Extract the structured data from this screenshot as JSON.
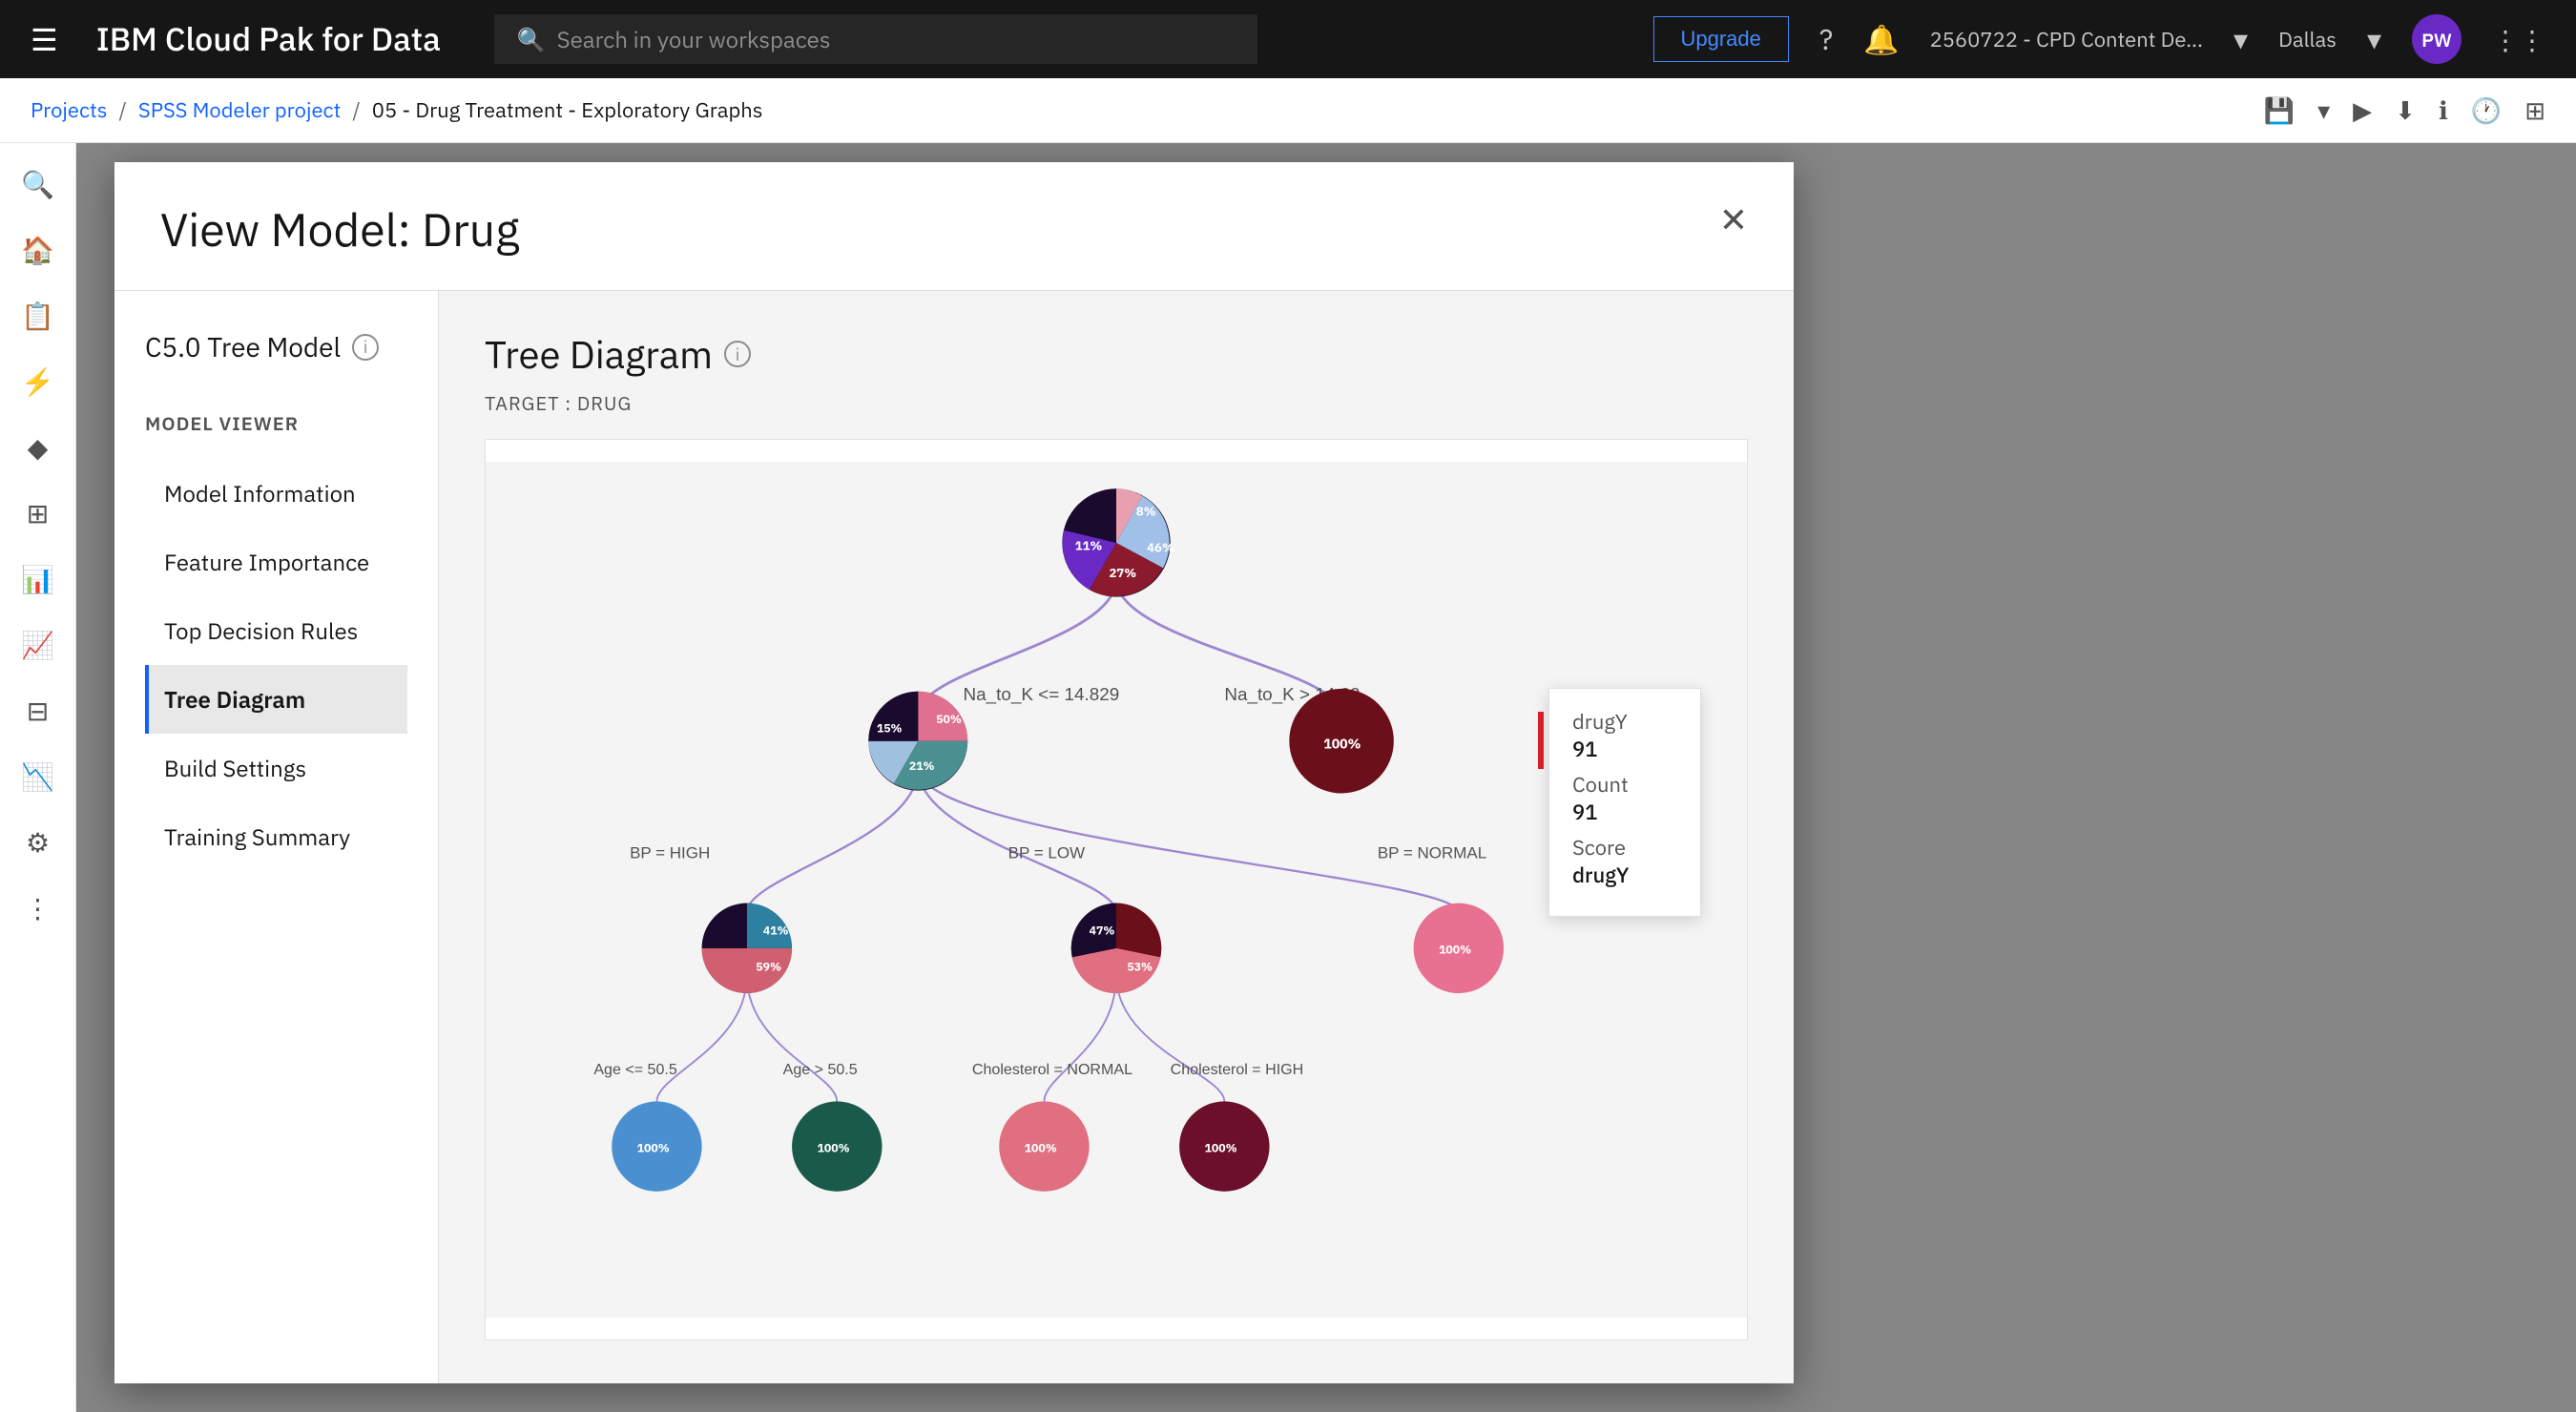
{
  "app": {
    "title": "IBM Cloud Pak for Data",
    "hamburger": "☰",
    "search_placeholder": "Search in your workspaces"
  },
  "nav": {
    "upgrade_label": "Upgrade",
    "workspace": "2560722 - CPD Content De...",
    "location": "Dallas",
    "user_initials": "PW"
  },
  "breadcrumb": {
    "projects": "Projects",
    "project": "SPSS Modeler project",
    "current": "05 - Drug Treatment - Exploratory Graphs"
  },
  "modal": {
    "title": "View Model: Drug",
    "close": "✕"
  },
  "model_sidebar": {
    "model_type": "C5.0 Tree Model",
    "viewer_label": "MODEL VIEWER",
    "nav_items": [
      {
        "id": "model-info",
        "label": "Model Information",
        "active": false
      },
      {
        "id": "feature-importance",
        "label": "Feature Importance",
        "active": false
      },
      {
        "id": "top-decision-rules",
        "label": "Top Decision Rules",
        "active": false
      },
      {
        "id": "tree-diagram",
        "label": "Tree Diagram",
        "active": true
      },
      {
        "id": "build-settings",
        "label": "Build Settings",
        "active": false
      },
      {
        "id": "training-summary",
        "label": "Training Summary",
        "active": false
      }
    ]
  },
  "tree_diagram": {
    "title": "Tree Diagram",
    "target_label": "TARGET : DRUG"
  },
  "tooltip": {
    "drug_label": "drugY",
    "drug_value": "91",
    "count_label": "Count",
    "count_value": "91",
    "score_label": "Score",
    "score_value": "drugY"
  },
  "tree_nodes": {
    "root": {
      "label": "",
      "pct_46": "46%",
      "pct_27": "27%",
      "pct_8": "8%",
      "pct_11": "11%"
    },
    "left_branch": "Na_to_K <= 14.829",
    "right_branch": "Na_to_K > 14.82",
    "node_left": {
      "pct_50": "50%",
      "pct_21": "21%",
      "pct_15": "15%"
    },
    "bp_high": "BP = HIGH",
    "bp_low": "BP = LOW",
    "bp_normal": "BP = NORMAL",
    "node_bp_high": {
      "pct_41": "41%",
      "pct_59": "59%"
    },
    "node_bp_low": {
      "pct_47": "47%",
      "pct_53": "53%"
    },
    "node_bp_normal": {
      "pct_100": "100%"
    },
    "age_le": "Age <= 50.5",
    "age_gt": "Age > 50.5",
    "chol_normal": "Cholesterol = NORMAL",
    "chol_high": "Cholesterol = HIGH",
    "leaf_age_le": "100%",
    "leaf_age_gt": "100%",
    "leaf_chol_normal": "100%",
    "leaf_chol_high": "100%",
    "leaf_right": "100%"
  }
}
